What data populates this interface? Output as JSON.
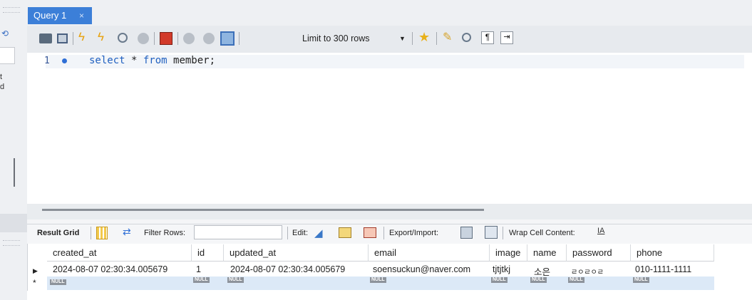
{
  "tab": {
    "title": "Query 1",
    "close": "×"
  },
  "toolbar": {
    "icons": [
      "open-folder-icon",
      "save-icon",
      "execute-icon",
      "execute-current-icon",
      "explain-icon",
      "stop-icon",
      "toggle-icon",
      "commit-icon",
      "rollback-icon",
      "autocommit-icon",
      "bookmark-icon",
      "beautify-icon",
      "find-icon",
      "invisible-chars-icon",
      "wrap-icon"
    ],
    "limit_label": "Limit to 300 rows"
  },
  "editor": {
    "line_number": "1",
    "sql_keyword1": "select",
    "sql_middle": " * ",
    "sql_keyword2": "from",
    "sql_rest": " member;"
  },
  "result_toolbar": {
    "result_grid": "Result Grid",
    "filter_rows": "Filter Rows:",
    "edit": "Edit:",
    "export_import": "Export/Import:",
    "wrap_cell": "Wrap Cell Content:"
  },
  "grid": {
    "columns": [
      "created_at",
      "id",
      "updated_at",
      "email",
      "image",
      "name",
      "password",
      "phone"
    ],
    "rows": [
      [
        "2024-08-07 02:30:34.005679",
        "1",
        "2024-08-07 02:30:34.005679",
        "soensuckun@naver.com",
        "tjtjtkj",
        "소은",
        "ㄹㅇㄹㅇㄹ",
        "010-1111-1111"
      ]
    ],
    "null_label": "NULL",
    "new_row_marker": "*"
  },
  "sidebar": {
    "frag1": "t",
    "frag2": "d"
  },
  "colors": {
    "tab_active": "#3c7fd8",
    "keyword": "#2060c0",
    "new_row": "#dce9f7"
  }
}
